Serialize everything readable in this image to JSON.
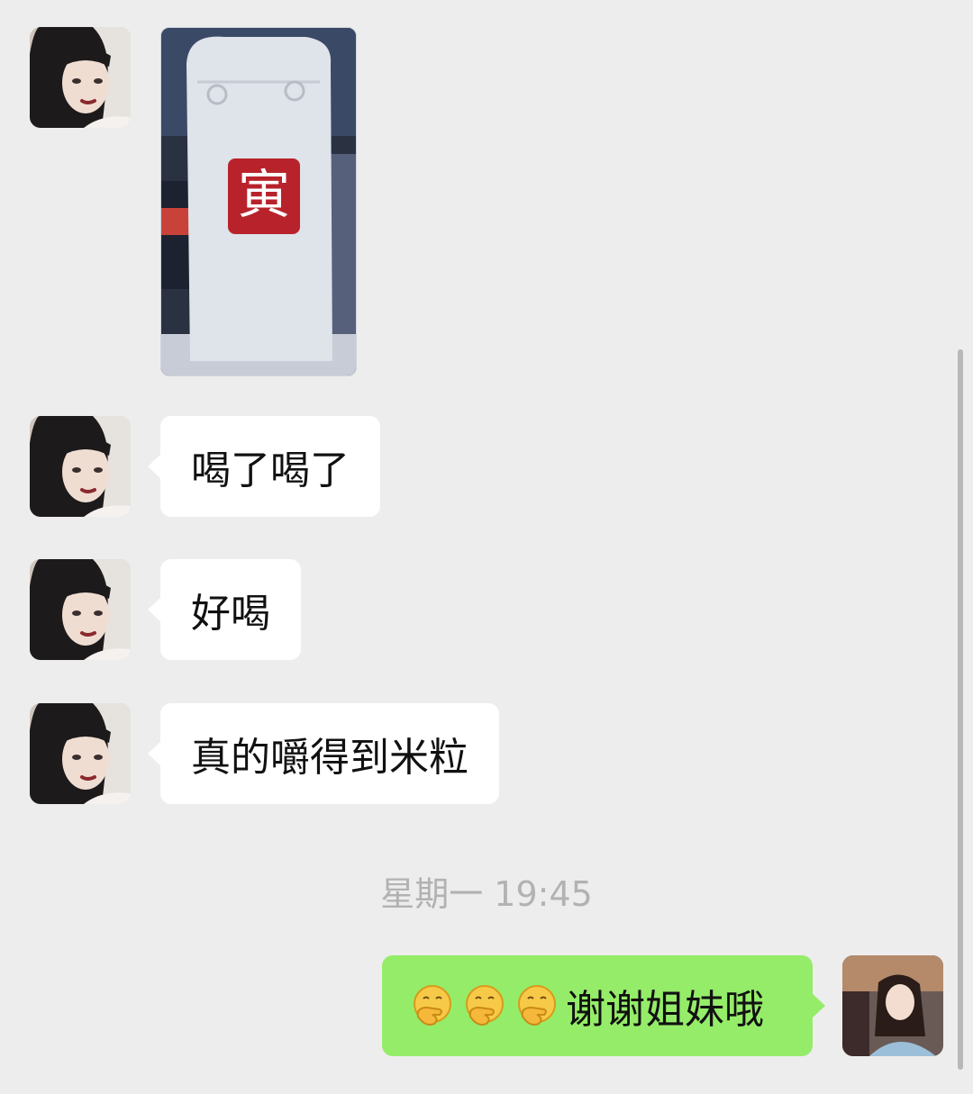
{
  "messages": [
    {
      "type": "image",
      "from": "contact"
    },
    {
      "type": "text",
      "from": "contact",
      "text": "喝了喝了"
    },
    {
      "type": "text",
      "from": "contact",
      "text": "好喝"
    },
    {
      "type": "text",
      "from": "contact",
      "text": "真的嚼得到米粒"
    }
  ],
  "timestamp": "星期一 19:45",
  "outgoing": {
    "from": "me",
    "emoji_icon": "hand-over-mouth-emoji",
    "emoji_count": 3,
    "text": "谢谢姐妹哦"
  },
  "photo": {
    "cup_label": "寅",
    "cup_label_color": "#b8232b"
  },
  "colors": {
    "background": "#ededed",
    "incoming_bubble": "#ffffff",
    "outgoing_bubble": "#95ec69",
    "timestamp_text": "#b2b2b2"
  }
}
